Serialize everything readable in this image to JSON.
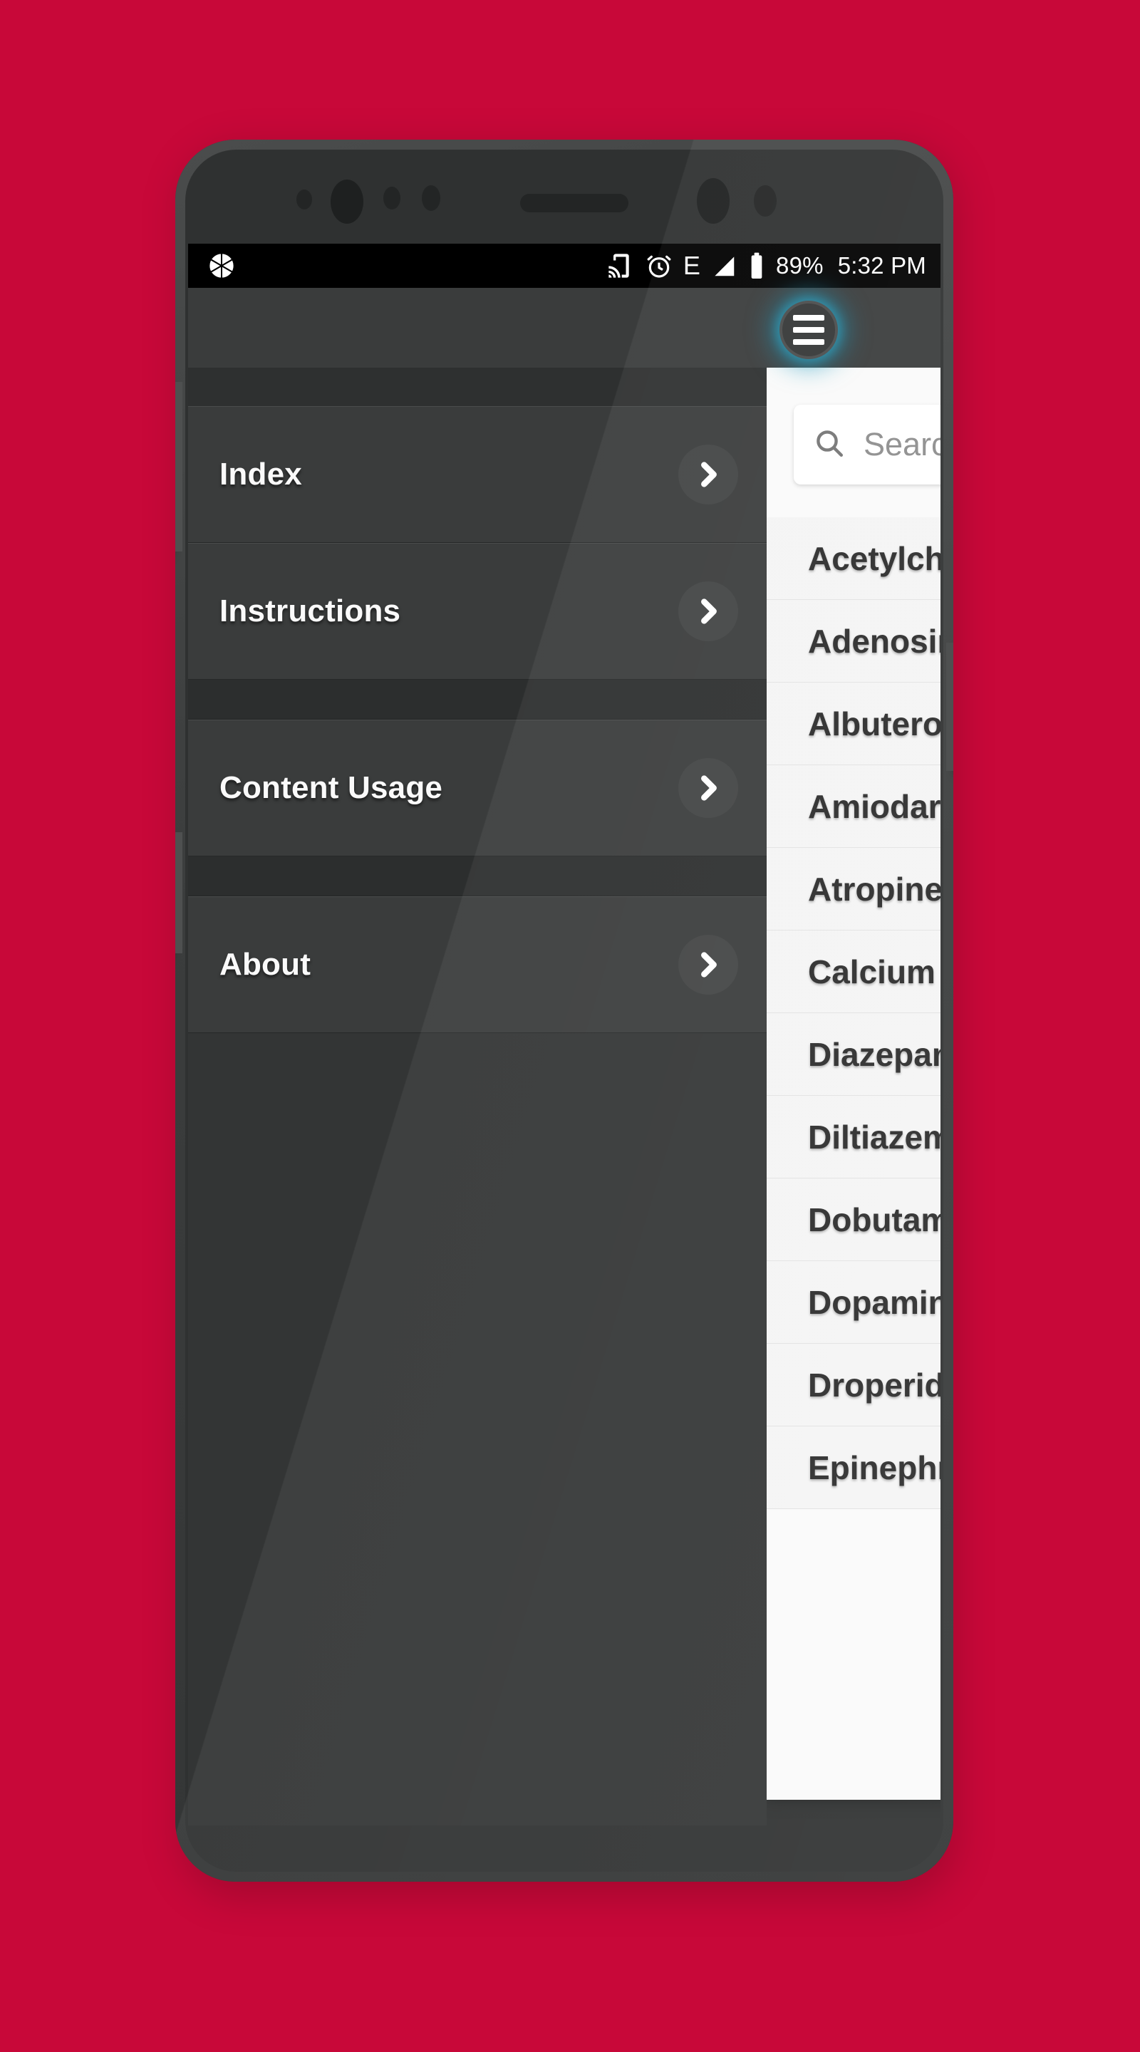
{
  "background": {
    "color": "#c80839"
  },
  "status_bar": {
    "left_icon": "screenshot-aperture-icon",
    "icons": [
      "cast-icon",
      "alarm-icon",
      "edge-network-icon",
      "signal-icon",
      "battery-icon"
    ],
    "network_label": "E",
    "battery_percent": "89%",
    "clock": "5:32 PM"
  },
  "toolbar": {
    "menu_button_label": "hamburger-menu"
  },
  "drawer": {
    "groups": [
      {
        "items": [
          {
            "label": "Index",
            "chevron": "chevron-right-icon"
          },
          {
            "label": "Instructions",
            "chevron": "chevron-right-icon"
          }
        ]
      },
      {
        "items": [
          {
            "label": "Content Usage",
            "chevron": "chevron-right-icon"
          }
        ]
      },
      {
        "items": [
          {
            "label": "About",
            "chevron": "chevron-right-icon"
          }
        ]
      }
    ]
  },
  "list_panel": {
    "search": {
      "icon": "search-icon",
      "placeholder": "Search",
      "value": ""
    },
    "items": [
      {
        "name": "Acetylcholine"
      },
      {
        "name": "Adenosine"
      },
      {
        "name": "Albuterol"
      },
      {
        "name": "Amiodarone"
      },
      {
        "name": "Atropine"
      },
      {
        "name": "Calcium"
      },
      {
        "name": "Diazepam"
      },
      {
        "name": "Diltiazem"
      },
      {
        "name": "Dobutamine"
      },
      {
        "name": "Dopamine"
      },
      {
        "name": "Droperidol"
      },
      {
        "name": "Epinephrine"
      }
    ]
  },
  "device": {
    "hardware": [
      "volume-up-button",
      "volume-down-button",
      "power-button",
      "front-camera",
      "earpiece-speaker",
      "proximity-sensor"
    ]
  }
}
